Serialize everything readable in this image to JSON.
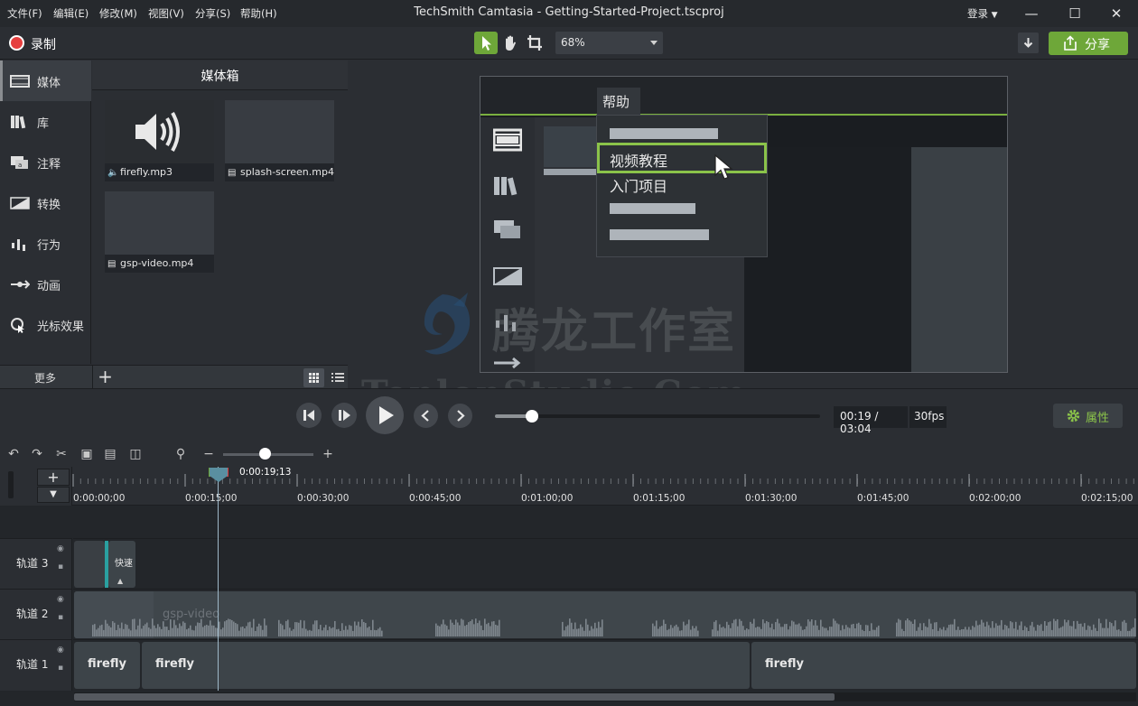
{
  "menu": [
    "文件(F)",
    "编辑(E)",
    "修改(M)",
    "视图(V)",
    "分享(S)",
    "帮助(H)"
  ],
  "app_title": "TechSmith Camtasia - Getting-Started-Project.tscproj",
  "login_label": "登录",
  "toolbar": {
    "record_label": "录制",
    "zoom_value": "68%",
    "share_label": "分享"
  },
  "left_tabs": [
    "媒体",
    "库",
    "注释",
    "转换",
    "行为",
    "动画",
    "光标效果"
  ],
  "more_label": "更多",
  "media_bin": {
    "title": "媒体箱",
    "items": [
      {
        "name": "firefly.mp3",
        "kind": "audio-icon"
      },
      {
        "name": "splash-screen.mp4",
        "kind": "video-icon"
      },
      {
        "name": "gsp-video.mp4",
        "kind": "video-icon"
      }
    ]
  },
  "preview": {
    "menu_title": "帮助",
    "items": [
      "视频教程",
      "入门项目"
    ]
  },
  "watermark": {
    "main": "腾龙工作室",
    "sub": "TenlonStudio.Com"
  },
  "playback": {
    "time": "00:19 / 03:04",
    "fps": "30fps",
    "progress": 0.115,
    "properties_label": "属性"
  },
  "timeline": {
    "playhead_time": "0:00:19;13",
    "ticks": [
      "0:00:00;00",
      "0:00:15;00",
      "0:00:30;00",
      "0:00:45;00",
      "0:01:00;00",
      "0:01:15;00",
      "0:01:30;00",
      "0:01:45;00",
      "0:02:00;00",
      "0:02:15;00"
    ],
    "tracks": [
      {
        "name": "轨道 3",
        "clips": [
          {
            "label": "快速"
          }
        ]
      },
      {
        "name": "轨道 2",
        "clips": [
          {
            "label": "gsp-video"
          }
        ]
      },
      {
        "name": "轨道 1",
        "clips": [
          {
            "label": "firefly"
          },
          {
            "label": "firefly"
          },
          {
            "label": "firefly"
          }
        ]
      }
    ]
  },
  "colors": {
    "accent": "#6ea739",
    "record": "#e63f3f",
    "highlight": "#8bc34a"
  }
}
